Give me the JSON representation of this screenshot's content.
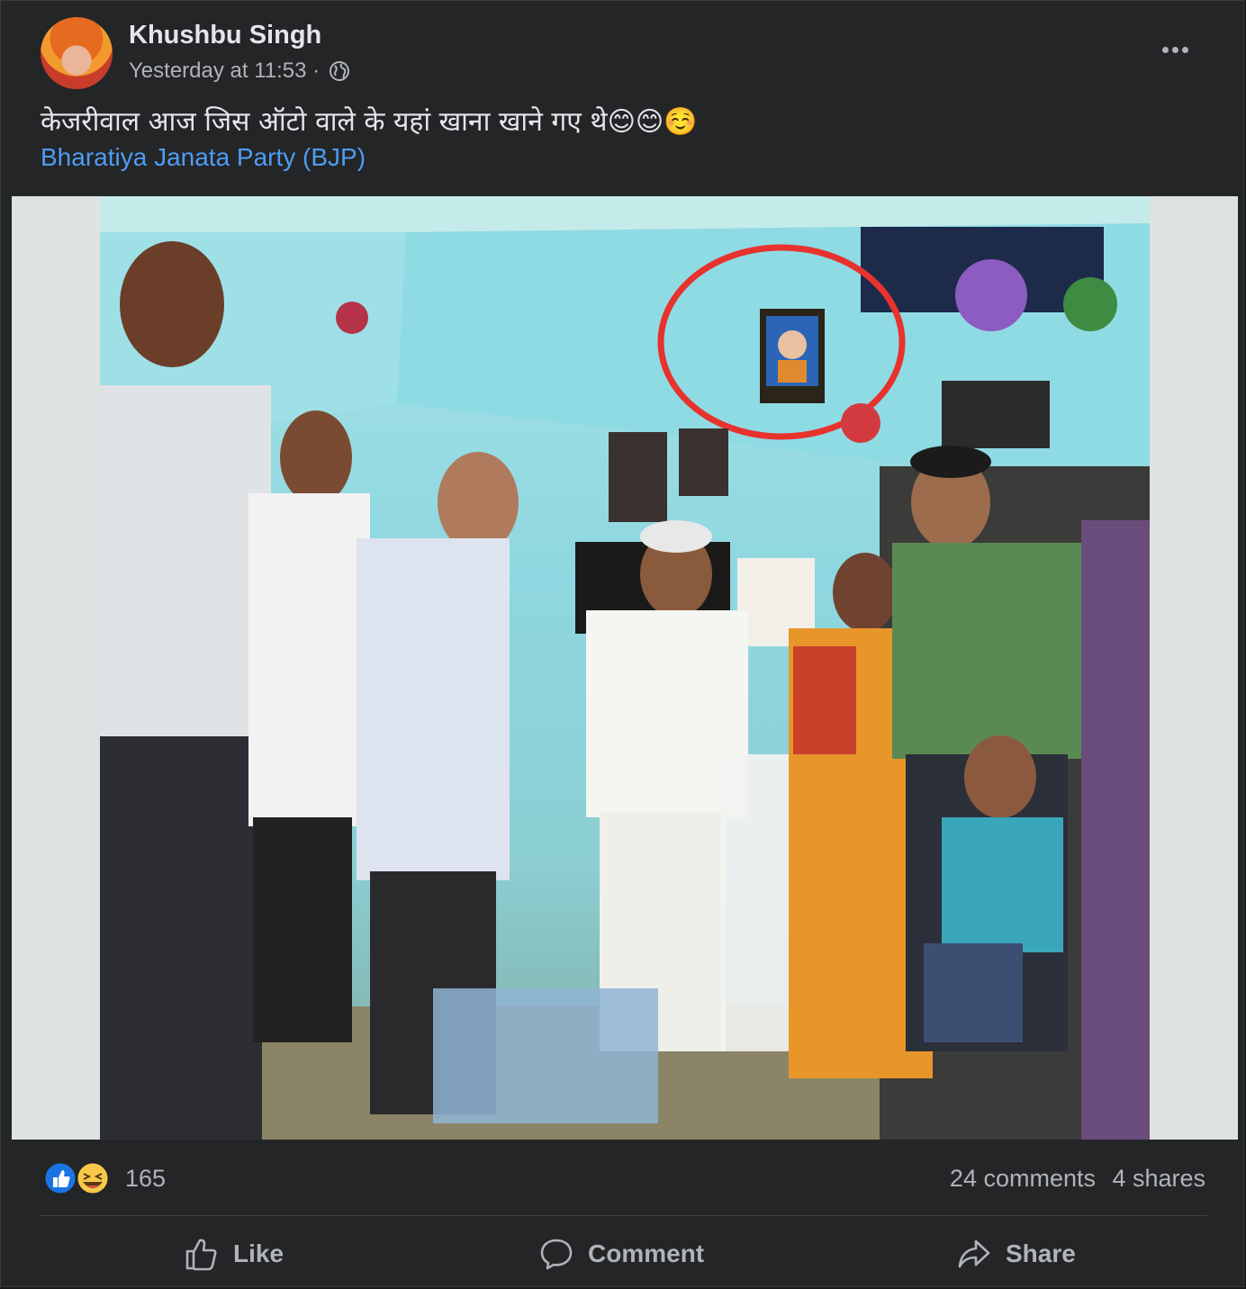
{
  "post": {
    "author": "Khushbu Singh",
    "timestamp": "Yesterday at 11:53 ·",
    "privacy_icon": "globe-icon",
    "text": "केजरीवाल आज जिस ऑटो वाले के यहां खाना खाने गए थे😊😊☺️",
    "tag_link": "Bharatiya Janata Party (BJP)"
  },
  "reactions": {
    "count": "165",
    "icons": [
      "like-reaction-icon",
      "haha-reaction-icon"
    ],
    "comments": "24 comments",
    "shares": "4 shares"
  },
  "actions": {
    "like": "Like",
    "comment": "Comment",
    "share": "Share"
  },
  "colors": {
    "card_bg": "#242526",
    "text_primary": "#e4e6eb",
    "text_secondary": "#b0b3b8",
    "link": "#4f9cf5",
    "like_blue": "#1b74e4",
    "haha_yellow": "#f7c94b",
    "highlight_red": "#e8322d"
  }
}
